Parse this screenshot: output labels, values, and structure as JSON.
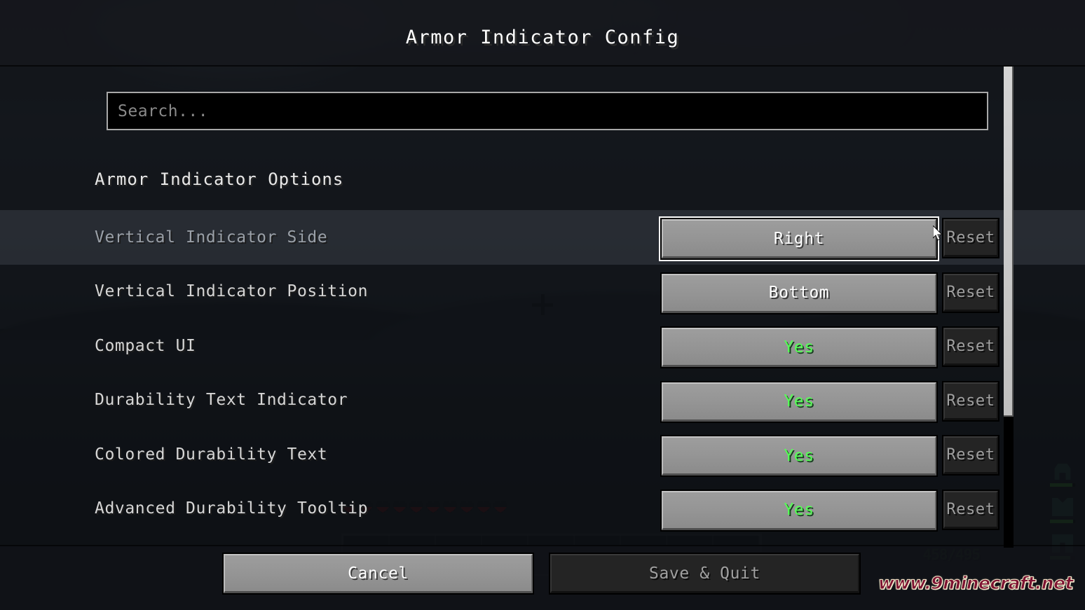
{
  "window": {
    "title": "Armor Indicator Config"
  },
  "search": {
    "value": "",
    "placeholder": "Search..."
  },
  "section": {
    "header": "Armor Indicator Options"
  },
  "options": [
    {
      "label": "Vertical Indicator Side",
      "value": "Right",
      "value_style": "plain",
      "reset_label": "Reset",
      "highlighted": true,
      "focused": true
    },
    {
      "label": "Vertical Indicator Position",
      "value": "Bottom",
      "value_style": "plain",
      "reset_label": "Reset",
      "highlighted": false,
      "focused": false
    },
    {
      "label": "Compact UI",
      "value": "Yes",
      "value_style": "green",
      "reset_label": "Reset",
      "highlighted": false,
      "focused": false
    },
    {
      "label": "Durability Text Indicator",
      "value": "Yes",
      "value_style": "green",
      "reset_label": "Reset",
      "highlighted": false,
      "focused": false
    },
    {
      "label": "Colored Durability Text",
      "value": "Yes",
      "value_style": "green",
      "reset_label": "Reset",
      "highlighted": false,
      "focused": false
    },
    {
      "label": "Advanced Durability Tooltip",
      "value": "Yes",
      "value_style": "green",
      "reset_label": "Reset",
      "highlighted": false,
      "focused": false
    }
  ],
  "footer": {
    "cancel_label": "Cancel",
    "save_label": "Save & Quit"
  },
  "hud": {
    "durability_text": "458/495",
    "armor_pieces": [
      "helmet",
      "chestplate",
      "leggings"
    ]
  },
  "watermark": {
    "text": "www.9minecraft.net"
  },
  "colors": {
    "green_value": "#55FF55",
    "button_face": "#949494",
    "disabled_button": "#242424",
    "focus_outline": "#FFFFFF",
    "watermark": "#7D1232"
  },
  "icons": {
    "cursor": "cursor-arrow-icon",
    "crosshair": "crosshair-icon",
    "scrollbar": "scrollbar-thumb"
  }
}
